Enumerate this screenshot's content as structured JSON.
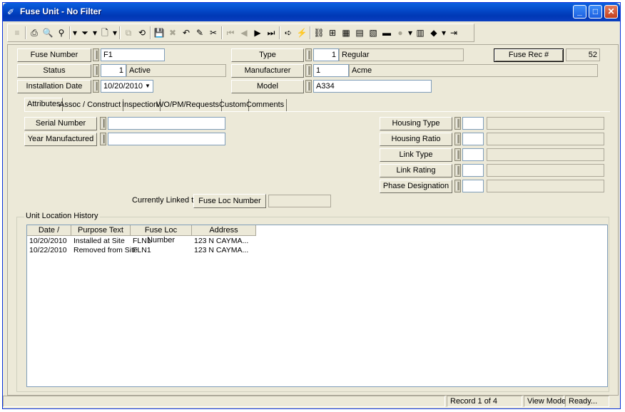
{
  "window": {
    "title": "Fuse Unit - No Filter",
    "minimize": "_",
    "maximize": "□",
    "close": "✕"
  },
  "toolbar": [
    {
      "icon": "grip-icon",
      "glyph": "≡",
      "dis": true
    },
    {
      "icon": "print-icon",
      "glyph": "⎙"
    },
    {
      "icon": "print-preview-icon",
      "glyph": "🔍"
    },
    {
      "icon": "search-icon",
      "glyph": "⚲"
    },
    {
      "icon": "dropdown-icon",
      "glyph": "▾"
    },
    {
      "icon": "filter-icon",
      "glyph": "⏷"
    },
    {
      "icon": "dropdown-icon",
      "glyph": "▾"
    },
    {
      "icon": "new-record-icon",
      "glyph": "🗋"
    },
    {
      "icon": "dropdown-icon",
      "glyph": "▾"
    },
    {
      "icon": "copy-record-icon",
      "glyph": "⧉",
      "dis": true
    },
    {
      "icon": "refresh-icon",
      "glyph": "⟲"
    },
    {
      "icon": "save-icon",
      "glyph": "💾",
      "dis": true
    },
    {
      "icon": "delete-icon",
      "glyph": "✖",
      "dis": true
    },
    {
      "icon": "undo-icon",
      "glyph": "↶"
    },
    {
      "icon": "edit-icon",
      "glyph": "✎"
    },
    {
      "icon": "cut-icon",
      "glyph": "✂"
    },
    {
      "icon": "first-record-icon",
      "glyph": "⏮",
      "dis": true
    },
    {
      "icon": "previous-record-icon",
      "glyph": "◀",
      "dis": true
    },
    {
      "icon": "next-record-icon",
      "glyph": "▶"
    },
    {
      "icon": "last-record-icon",
      "glyph": "⏭"
    },
    {
      "icon": "go-to-icon",
      "glyph": "➪"
    },
    {
      "icon": "lightning-icon",
      "glyph": "⚡"
    },
    {
      "icon": "link-icon",
      "glyph": "⛓"
    },
    {
      "icon": "hierarchy-icon",
      "glyph": "⊞"
    },
    {
      "icon": "map-icon",
      "glyph": "▦"
    },
    {
      "icon": "calendar-icon",
      "glyph": "▤"
    },
    {
      "icon": "chart-icon",
      "glyph": "▧"
    },
    {
      "icon": "tool-icon",
      "glyph": "▬"
    },
    {
      "icon": "globe-icon",
      "glyph": "●",
      "dis": true
    },
    {
      "icon": "dropdown-icon",
      "glyph": "▾"
    },
    {
      "icon": "report-icon",
      "glyph": "▥"
    },
    {
      "icon": "book-icon",
      "glyph": "◆"
    },
    {
      "icon": "dropdown-icon",
      "glyph": "▾"
    },
    {
      "icon": "exit-icon",
      "glyph": "⇥"
    }
  ],
  "header": {
    "fuse_number_label": "Fuse Number",
    "fuse_number_value": "F1",
    "status_label": "Status",
    "status_code": "1",
    "status_text": "Active",
    "installation_date_label": "Installation Date",
    "installation_date_value": "10/20/2010",
    "type_label": "Type",
    "type_code": "1",
    "type_text": "Regular",
    "manufacturer_label": "Manufacturer",
    "manufacturer_code": "1",
    "manufacturer_text": "Acme",
    "model_label": "Model",
    "model_value": "A334",
    "fuse_rec_label": "Fuse Rec #",
    "fuse_rec_value": "52"
  },
  "tabs": [
    "Attributes",
    "Assoc / Construct",
    "Inspection",
    "WO/PM/Requests",
    "Custom",
    "Comments"
  ],
  "attributes": {
    "serial_number_label": "Serial Number",
    "year_manufactured_label": "Year Manufactured",
    "housing_type_label": "Housing Type",
    "housing_ratio_label": "Housing Ratio",
    "link_type_label": "Link Type",
    "link_rating_label": "Link Rating",
    "phase_designation_label": "Phase Designation",
    "currently_linked_label": "Currently Linked to",
    "fuse_loc_number_label": "Fuse Loc Number"
  },
  "history": {
    "group_label": "Unit Location History",
    "columns": [
      "Date /",
      "Purpose Text",
      "Fuse Loc Number",
      "Address"
    ],
    "rows": [
      [
        "10/20/2010",
        "Installed at Site",
        "FLN1",
        "123 N CAYMA..."
      ],
      [
        "10/22/2010",
        "Removed from Site",
        "FLN1",
        "123 N CAYMA..."
      ]
    ]
  },
  "status": {
    "record": "Record 1 of 4",
    "mode": "View Mode",
    "state": "Ready..."
  }
}
